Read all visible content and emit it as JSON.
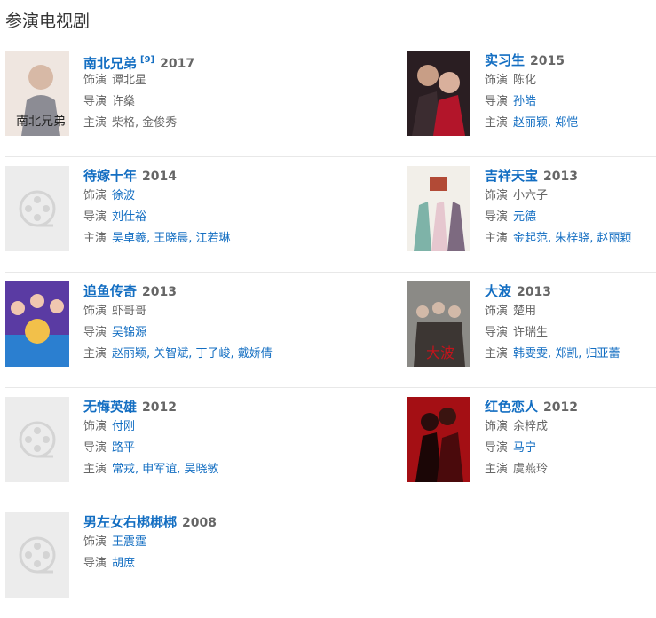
{
  "section": {
    "title": "参演电视剧"
  },
  "items": [
    {
      "title": "南北兄弟",
      "note": "[9]",
      "year": "2017",
      "role_label": "饰演",
      "role": "谭北星",
      "director_label": "导演",
      "director": "许燊",
      "cast_label": "主演",
      "cast": "柴格, 金俊秀"
    },
    {
      "title": "实习生",
      "year": "2015",
      "role_label": "饰演",
      "role": "陈化",
      "director_label": "导演",
      "director": "孙皓",
      "cast_label": "主演",
      "cast": "赵丽颖, 郑恺"
    },
    {
      "title": "待嫁十年",
      "year": "2014",
      "role_label": "饰演",
      "role": "徐波",
      "director_label": "导演",
      "director": "刘仕裕",
      "cast_label": "主演",
      "cast": "吴卓羲, 王晓晨, 江若琳"
    },
    {
      "title": "吉祥天宝",
      "year": "2013",
      "role_label": "饰演",
      "role": "小六子",
      "director_label": "导演",
      "director": "元德",
      "cast_label": "主演",
      "cast": "金起范, 朱梓骁, 赵丽颖"
    },
    {
      "title": "追鱼传奇",
      "year": "2013",
      "role_label": "饰演",
      "role": "虾哥哥",
      "director_label": "导演",
      "director": "吴锦源",
      "cast_label": "主演",
      "cast": "赵丽颖, 关智斌, 丁子峻, 戴娇倩"
    },
    {
      "title": "大波",
      "year": "2013",
      "role_label": "饰演",
      "role": "楚用",
      "director_label": "导演",
      "director": "许瑞生",
      "cast_label": "主演",
      "cast": "韩雯雯, 郑凯, 归亚蕾"
    },
    {
      "title": "无悔英雄",
      "year": "2012",
      "role_label": "饰演",
      "role": "付刚",
      "director_label": "导演",
      "director": "路平",
      "cast_label": "主演",
      "cast": "常戎, 申军谊, 吴晓敏"
    },
    {
      "title": "红色恋人",
      "year": "2012",
      "role_label": "饰演",
      "role": "余梓成",
      "director_label": "导演",
      "director": "马宁",
      "cast_label": "主演",
      "cast": "虞燕玲"
    },
    {
      "title": "男左女右梆梆梆",
      "year": "2008",
      "role_label": "饰演",
      "role": "王震霆",
      "director_label": "导演",
      "director": "胡庶"
    }
  ]
}
